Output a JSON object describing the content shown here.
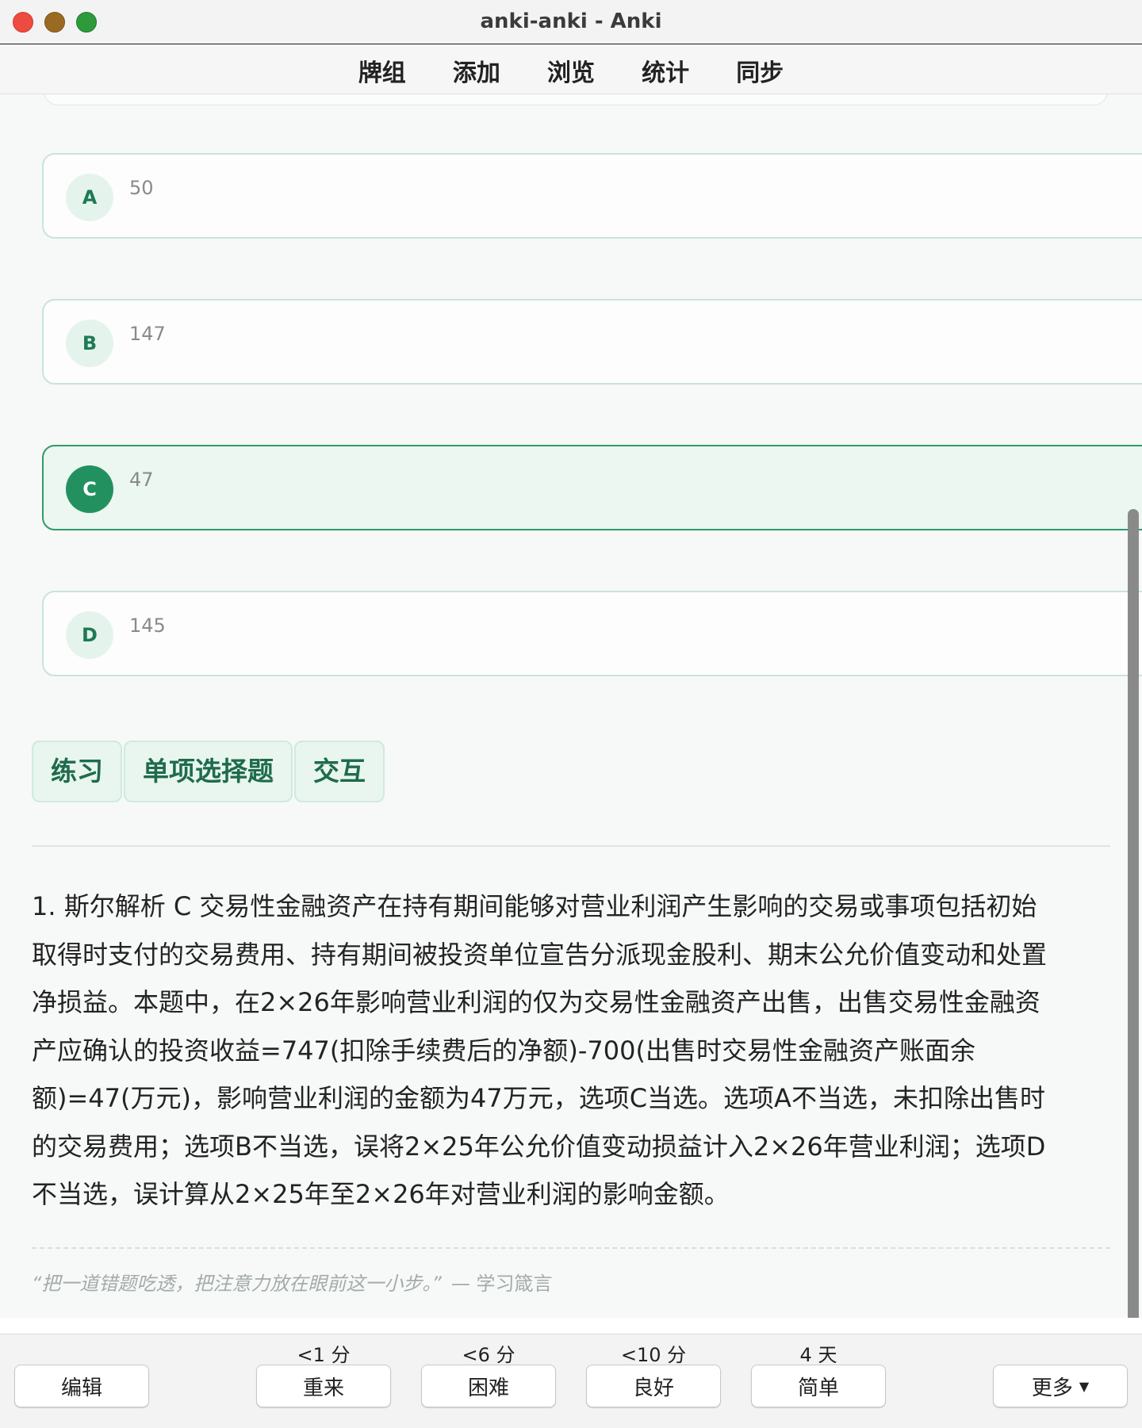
{
  "window": {
    "title": "anki-anki - Anki"
  },
  "toolbar": {
    "items": [
      "牌组",
      "添加",
      "浏览",
      "统计",
      "同步"
    ]
  },
  "options": [
    {
      "letter": "A",
      "text": "50",
      "selected": false
    },
    {
      "letter": "B",
      "text": "147",
      "selected": false
    },
    {
      "letter": "C",
      "text": "47",
      "selected": true
    },
    {
      "letter": "D",
      "text": "145",
      "selected": false
    }
  ],
  "tags": [
    "练习",
    "单项选择题",
    "交互"
  ],
  "explanation": {
    "lines": [
      "1. 斯尔解析 C 交易性金融资产在持有期间能够对营业利润产生影响的交易或事项包括初始",
      "取得时支付的交易费用、持有期间被投资单位宣告分派现金股利、期末公允价值变动和处置",
      "净损益。本题中，在2×26年影响营业利润的仅为交易性金融资产出售，出售交易性金融资",
      "产应确认的投资收益=747(扣除手续费后的净额)-700(出售时交易性金融资产账面余",
      "额)=47(万元)，影响营业利润的金额为47万元，选项C当选。选项A不当选，未扣除出售时",
      "的交易费用；选项B不当选，误将2×25年公允价值变动损益计入2×26年营业利润；选项D",
      "不当选，误计算从2×25年至2×26年对营业利润的影响金额。"
    ]
  },
  "quote": {
    "text": "“把一道错题吃透，把注意力放在眼前这一小步。”",
    "source": "— 学习箴言"
  },
  "bottom": {
    "edit_label": "编辑",
    "more_label": "更多",
    "answers": [
      {
        "label": "重来",
        "interval": "<1 分"
      },
      {
        "label": "困难",
        "interval": "<6 分"
      },
      {
        "label": "良好",
        "interval": "<10 分"
      },
      {
        "label": "简单",
        "interval": "4 天"
      }
    ]
  },
  "colors": {
    "accent": "#22915f",
    "selected_bg": "#ebf7f0",
    "tag_bg": "#e8f6ef"
  }
}
